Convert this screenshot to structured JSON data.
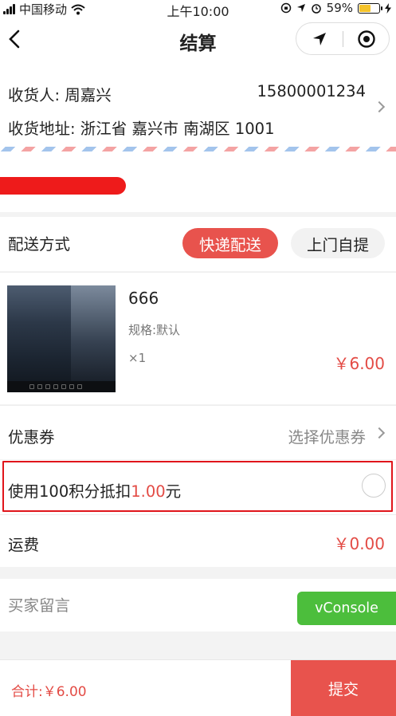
{
  "status_bar": {
    "carrier": "中国移动",
    "time": "上午10:00",
    "battery": "59%",
    "battery_level": 0.59
  },
  "nav": {
    "title": "结算",
    "back_icon": "chevron-left-icon",
    "location_icon": "location-arrow-icon",
    "target_icon": "target-icon"
  },
  "address": {
    "receiver": "收货人: 周嘉兴",
    "phone": "15800001234",
    "detail": "收货地址: 浙江省 嘉兴市 南湖区 1001"
  },
  "delivery": {
    "label": "配送方式",
    "options": [
      "快递配送",
      "上门自提"
    ],
    "selected": "快递配送"
  },
  "product": {
    "name": "666",
    "spec": "规格:默认",
    "qty": "×1",
    "price": "￥6.00"
  },
  "coupon": {
    "label": "优惠券",
    "value": "选择优惠券"
  },
  "points": {
    "prefix": "使用100积分抵扣",
    "amount": "1.00",
    "suffix": "元"
  },
  "shipping": {
    "label": "运费",
    "value": "￥0.00"
  },
  "message": {
    "placeholder": "买家留言"
  },
  "vconsole": {
    "label": "vConsole"
  },
  "footer": {
    "total": "合计:￥6.00",
    "submit": "提交"
  },
  "colors": {
    "accent": "#e8534d",
    "price": "#e34b45",
    "vconsole": "#4cbe3c",
    "highlight": "#e0151b"
  }
}
